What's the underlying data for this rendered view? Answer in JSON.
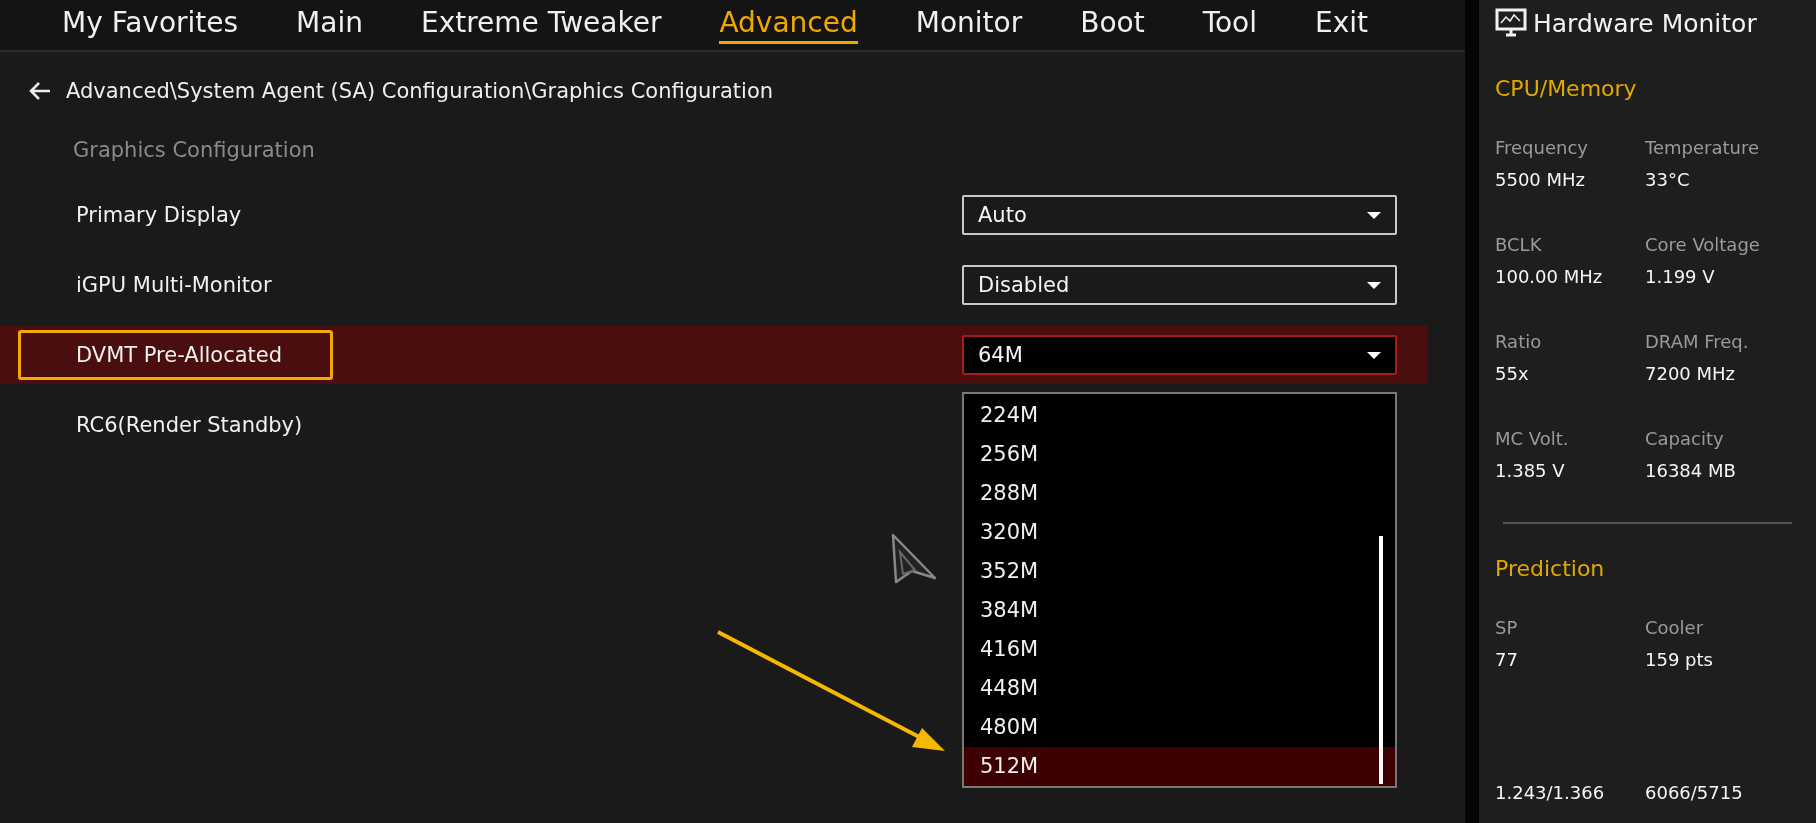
{
  "tabs": [
    {
      "label": "My Favorites",
      "selected": false
    },
    {
      "label": "Main",
      "selected": false
    },
    {
      "label": "Extreme Tweaker",
      "selected": false
    },
    {
      "label": "Advanced",
      "selected": true
    },
    {
      "label": "Monitor",
      "selected": false
    },
    {
      "label": "Boot",
      "selected": false
    },
    {
      "label": "Tool",
      "selected": false
    },
    {
      "label": "Exit",
      "selected": false
    }
  ],
  "breadcrumb": "Advanced\\System Agent (SA) Configuration\\Graphics Configuration",
  "section_title": "Graphics Configuration",
  "settings": [
    {
      "label": "Primary Display",
      "value": "Auto",
      "focused": false
    },
    {
      "label": "iGPU Multi-Monitor",
      "value": "Disabled",
      "focused": false
    },
    {
      "label": "DVMT Pre-Allocated",
      "value": "64M",
      "focused": true
    },
    {
      "label": "RC6(Render Standby)",
      "focused": false
    }
  ],
  "dropdown_options": [
    {
      "label": "224M",
      "selected": false
    },
    {
      "label": "256M",
      "selected": false
    },
    {
      "label": "288M",
      "selected": false
    },
    {
      "label": "320M",
      "selected": false
    },
    {
      "label": "352M",
      "selected": false
    },
    {
      "label": "384M",
      "selected": false
    },
    {
      "label": "416M",
      "selected": false
    },
    {
      "label": "448M",
      "selected": false
    },
    {
      "label": "480M",
      "selected": false
    },
    {
      "label": "512M",
      "selected": true
    }
  ],
  "hardware_monitor": {
    "title": "Hardware Monitor",
    "sections": [
      {
        "title": "CPU/Memory",
        "items": [
          {
            "label": "Frequency",
            "value": "5500 MHz"
          },
          {
            "label": "Temperature",
            "value": "33°C"
          },
          {
            "label": "BCLK",
            "value": "100.00 MHz"
          },
          {
            "label": "Core Voltage",
            "value": "1.199 V"
          },
          {
            "label": "Ratio",
            "value": "55x"
          },
          {
            "label": "DRAM Freq.",
            "value": "7200 MHz"
          },
          {
            "label": "MC Volt.",
            "value": "1.385 V"
          },
          {
            "label": "Capacity",
            "value": "16384 MB"
          }
        ]
      },
      {
        "title": "Prediction",
        "items": [
          {
            "label": "SP",
            "value": "77"
          },
          {
            "label": "Cooler",
            "value": "159 pts"
          },
          {
            "value": "1.243/1.366"
          },
          {
            "value": "6066/5715"
          }
        ]
      }
    ]
  }
}
